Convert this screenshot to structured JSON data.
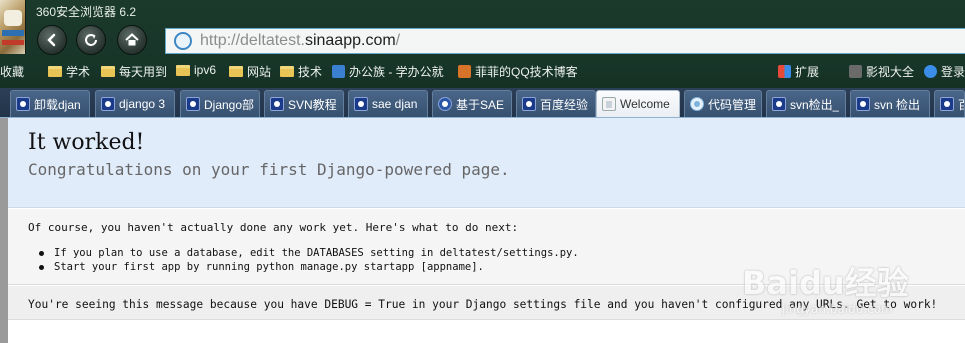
{
  "window": {
    "title": "360安全浏览器 6.2"
  },
  "address_bar": {
    "url_prefix": "http://deltatest.",
    "url_host": "sinaapp.com",
    "url_suffix": "/"
  },
  "bookmarks": {
    "items": [
      {
        "label": "收藏",
        "type": "text"
      },
      {
        "label": "学术",
        "type": "folder"
      },
      {
        "label": "每天用到",
        "type": "folder"
      },
      {
        "label": "ipv6",
        "type": "folder"
      },
      {
        "label": "网站",
        "type": "folder"
      },
      {
        "label": "技术",
        "type": "folder"
      },
      {
        "label": "办公族 - 学办公就",
        "type": "site"
      },
      {
        "label": "菲菲的QQ技术博客",
        "type": "site"
      }
    ],
    "right": {
      "extend": "扩展",
      "video": "影视大全",
      "login": "登录"
    }
  },
  "tabs": [
    {
      "label": "卸载djan",
      "icon": "django"
    },
    {
      "label": "django 3",
      "icon": "django"
    },
    {
      "label": "Django部",
      "icon": "django"
    },
    {
      "label": "SVN教程",
      "icon": "django"
    },
    {
      "label": "sae djan",
      "icon": "django"
    },
    {
      "label": "基于SAE",
      "icon": "swirl"
    },
    {
      "label": "百度经验",
      "icon": "django"
    },
    {
      "label": "Welcome",
      "icon": "doc",
      "active": true
    },
    {
      "label": "代码管理",
      "icon": "cloud"
    },
    {
      "label": "svn检出_",
      "icon": "django"
    },
    {
      "label": "svn 检出",
      "icon": "django"
    },
    {
      "label": "百",
      "icon": "django"
    }
  ],
  "page": {
    "title": "It worked!",
    "subtitle": "Congratulations on your first Django-powered page.",
    "instructions_intro": "Of course, you haven't actually done any work yet. Here's what to do next:",
    "steps": [
      "If you plan to use a database, edit the DATABASES setting in deltatest/settings.py.",
      "Start your first app by running python manage.py startapp [appname]."
    ],
    "explanation": "You're seeing this message because you have DEBUG = True in your Django settings file and you haven't configured any URLs. Get to work!"
  },
  "watermark": {
    "brand": "Baidu经验",
    "url": "jingyan.baidu.com"
  }
}
